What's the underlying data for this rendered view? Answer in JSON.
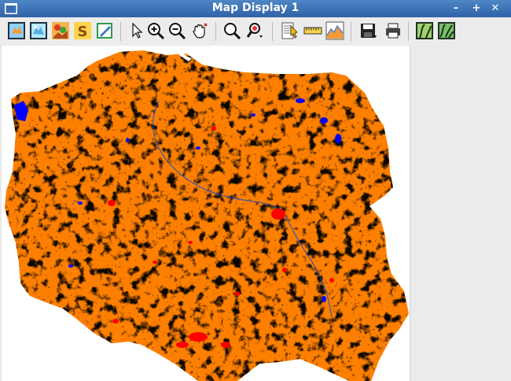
{
  "window": {
    "title": "Map Display 1",
    "controls": [
      "minimize",
      "maximize",
      "close"
    ]
  },
  "toolbar": {
    "groups": [
      [
        "display-map-icon",
        "display-raster-icon",
        "display-rgb-icon",
        "display-shaded-icon",
        "overlay-edit-icon"
      ],
      [
        "pointer-icon",
        "zoom-in-icon",
        "zoom-out-icon",
        "pan-hand-icon"
      ],
      [
        "zoom-back-icon",
        "zoom-options-icon"
      ],
      [
        "query-icon",
        "measure-icon",
        "profile-icon"
      ],
      [
        "save-icon",
        "print-icon"
      ],
      [
        "2d-view-icon",
        "3d-view-icon"
      ]
    ]
  },
  "map": {
    "layer_colors": {
      "background": "#ffffff",
      "agriculture": "#ff8000",
      "forest": "#00ff00",
      "urban": "#ff0000",
      "water": "#0000ff"
    }
  }
}
